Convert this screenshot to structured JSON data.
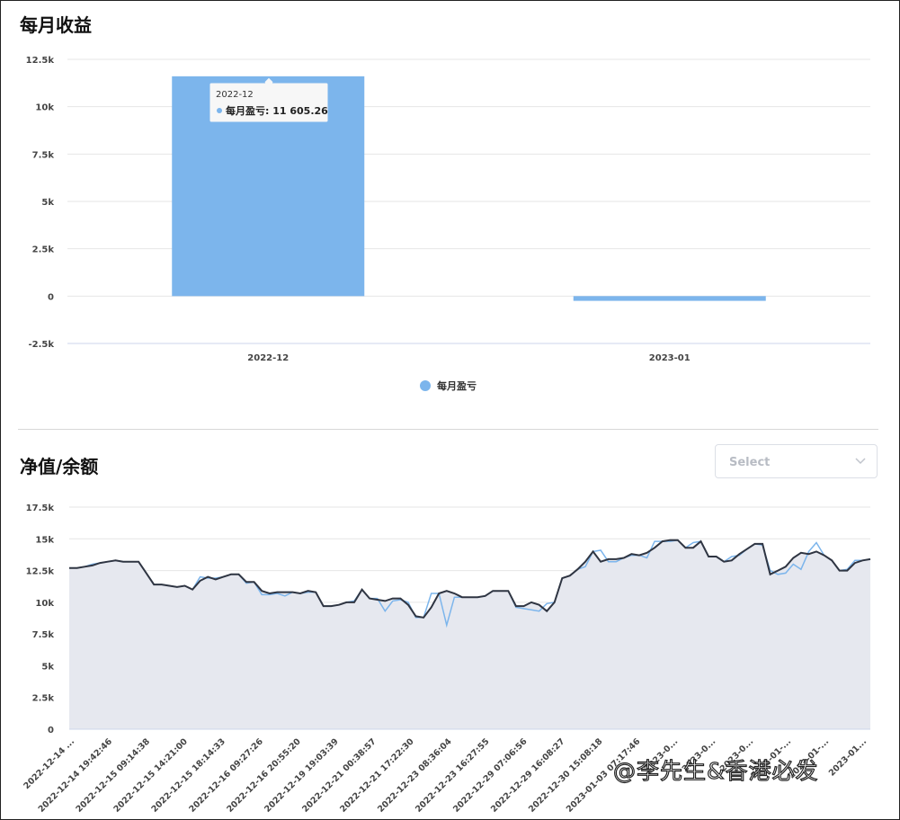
{
  "sections": {
    "monthly_title": "每月收益",
    "nav_title": "净值/余额"
  },
  "select": {
    "placeholder": "Select"
  },
  "tooltip": {
    "title": "2022-12",
    "label": "每月盈亏: 11 605.26"
  },
  "watermark": "@李先生&香港必发",
  "colors": {
    "bar": "#7cb5ec",
    "line_light": "#7cb5ec",
    "line_dark": "#2f3542",
    "area": "#e6e8ef"
  },
  "chart_data": [
    {
      "type": "bar",
      "title": "每月收益",
      "categories": [
        "2022-12",
        "2023-01"
      ],
      "series": [
        {
          "name": "每月盈亏",
          "values": [
            11605.26,
            -250
          ]
        }
      ],
      "ylim": [
        -2500,
        12500
      ],
      "yticks": [
        "12.5k",
        "10k",
        "7.5k",
        "5k",
        "2.5k",
        "0",
        "-2.5k"
      ],
      "legend": "bottom-center",
      "grid": true
    },
    {
      "type": "area",
      "title": "净值/余额",
      "ylim": [
        0,
        17500
      ],
      "yticks": [
        "17.5k",
        "15k",
        "12.5k",
        "10k",
        "7.5k",
        "5k",
        "2.5k",
        "0"
      ],
      "xticks": [
        "2022-12-14 ...",
        "2022-12-14 19:42:46",
        "2022-12-15 09:14:38",
        "2022-12-15 14:21:00",
        "2022-12-15 18:14:33",
        "2022-12-16 09:27:26",
        "2022-12-16 20:55:20",
        "2022-12-19 19:03:39",
        "2022-12-21 00:38:57",
        "2022-12-21 17:22:30",
        "2022-12-23 08:36:04",
        "2022-12-23 16:27:55",
        "2022-12-29 07:06:56",
        "2022-12-29 16:08:27",
        "2022-12-30 15:08:18",
        "2023-01-03 07:17:46",
        "2023-0...",
        "2023-0...",
        "2023-0...",
        "2023-01-...",
        "2023-01-...",
        "2023-01..."
      ],
      "series": [
        {
          "name": "净值",
          "values": [
            12700,
            12700,
            12800,
            13000,
            13100,
            13200,
            13300,
            13200,
            13200,
            13200,
            12300,
            11400,
            11400,
            11300,
            11200,
            11300,
            11000,
            12000,
            11900,
            11900,
            12000,
            12200,
            12200,
            11500,
            11600,
            10600,
            10600,
            10700,
            10500,
            10800,
            10700,
            10800,
            10800,
            9700,
            9700,
            9800,
            10000,
            10100,
            11000,
            10300,
            10300,
            9300,
            10100,
            10200,
            10000,
            8800,
            8800,
            10700,
            10700,
            8200,
            10400,
            10400,
            10400,
            10400,
            10500,
            10900,
            10900,
            10900,
            9600,
            9500,
            9400,
            9300,
            9900,
            10000,
            11900,
            12100,
            12600,
            12800,
            14000,
            14100,
            13200,
            13200,
            13500,
            13700,
            13700,
            13500,
            14800,
            14800,
            14800,
            14900,
            14300,
            14700,
            14800,
            13600,
            13600,
            13200,
            13600,
            13700,
            14200,
            14600,
            14500,
            12500,
            12200,
            12300,
            13000,
            12600,
            14000,
            14700,
            13700,
            13300,
            12500,
            12600,
            13300,
            13300,
            13400
          ]
        },
        {
          "name": "余额",
          "values": [
            12700,
            12700,
            12800,
            12900,
            13100,
            13200,
            13300,
            13200,
            13200,
            13200,
            12300,
            11400,
            11400,
            11300,
            11200,
            11300,
            11000,
            11700,
            12000,
            11800,
            12000,
            12200,
            12200,
            11600,
            11600,
            10900,
            10700,
            10800,
            10800,
            10800,
            10700,
            10900,
            10800,
            9700,
            9700,
            9800,
            10000,
            10000,
            11000,
            10300,
            10200,
            10100,
            10300,
            10300,
            9800,
            8900,
            8800,
            9600,
            10700,
            10900,
            10700,
            10400,
            10400,
            10400,
            10500,
            10900,
            10900,
            10900,
            9700,
            9700,
            10000,
            9800,
            9300,
            10000,
            11900,
            12100,
            12600,
            13200,
            14000,
            13200,
            13400,
            13400,
            13500,
            13800,
            13700,
            13900,
            14300,
            14800,
            14900,
            14900,
            14300,
            14300,
            14800,
            13600,
            13600,
            13200,
            13300,
            13800,
            14200,
            14600,
            14600,
            12200,
            12500,
            12800,
            13500,
            13900,
            13800,
            14000,
            13700,
            13300,
            12500,
            12500,
            13100,
            13300,
            13400
          ]
        }
      ],
      "legend": "none",
      "grid": true
    }
  ]
}
